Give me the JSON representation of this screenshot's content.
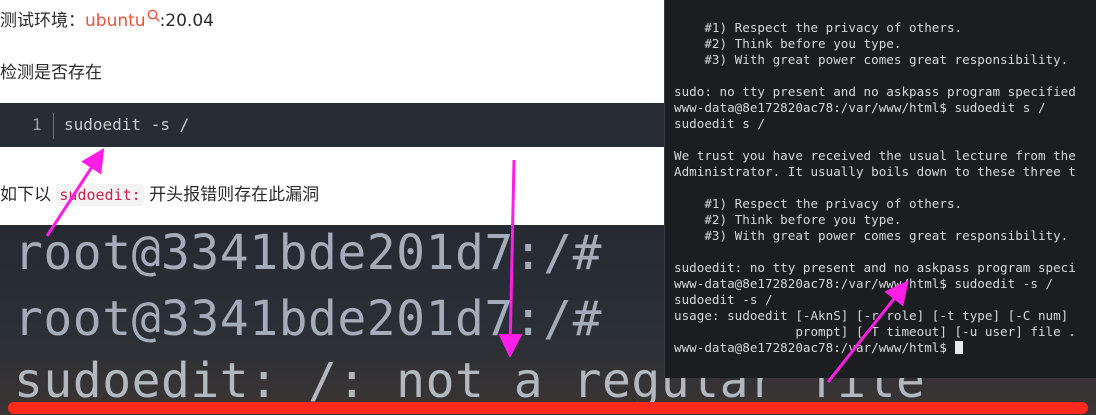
{
  "article": {
    "env_label": "测试环境：",
    "env_keyword": "ubuntu",
    "env_version": ":20.04",
    "check_text": "检测是否存在",
    "code_block": {
      "line_number": "1",
      "code": "sudoedit -s /"
    },
    "desc_prefix": "如下以",
    "desc_code": "sudoedit:",
    "desc_suffix": "开头报错则存在此漏洞"
  },
  "zoomed_terminal": {
    "lines": [
      "root@3341bde201d7:/#",
      "root@3341bde201d7:/#",
      "sudoedit: /: not a regular file"
    ]
  },
  "terminal": {
    "lines": [
      "",
      "    #1) Respect the privacy of others.",
      "    #2) Think before you type.",
      "    #3) With great power comes great responsibility.",
      "",
      "sudo: no tty present and no askpass program specified",
      "www-data@8e172820ac78:/var/www/html$ sudoedit s /",
      "sudoedit s /",
      "",
      "We trust you have received the usual lecture from the",
      "Administrator. It usually boils down to these three t",
      "",
      "    #1) Respect the privacy of others.",
      "    #2) Think before you type.",
      "    #3) With great power comes great responsibility.",
      "",
      "sudoedit: no tty present and no askpass program speci",
      "www-data@8e172820ac78:/var/www/html$ sudoedit -s /",
      "sudoedit -s /",
      "usage: sudoedit [-AknS] [-r role] [-t type] [-C num]",
      "                prompt] [-T timeout] [-u user] file .",
      "www-data@8e172820ac78:/var/www/html$ "
    ]
  },
  "colors": {
    "annotation_arrow": "#ff1ee6",
    "highlight_bar": "#ff2a1c",
    "keyword": "#e4553c"
  }
}
